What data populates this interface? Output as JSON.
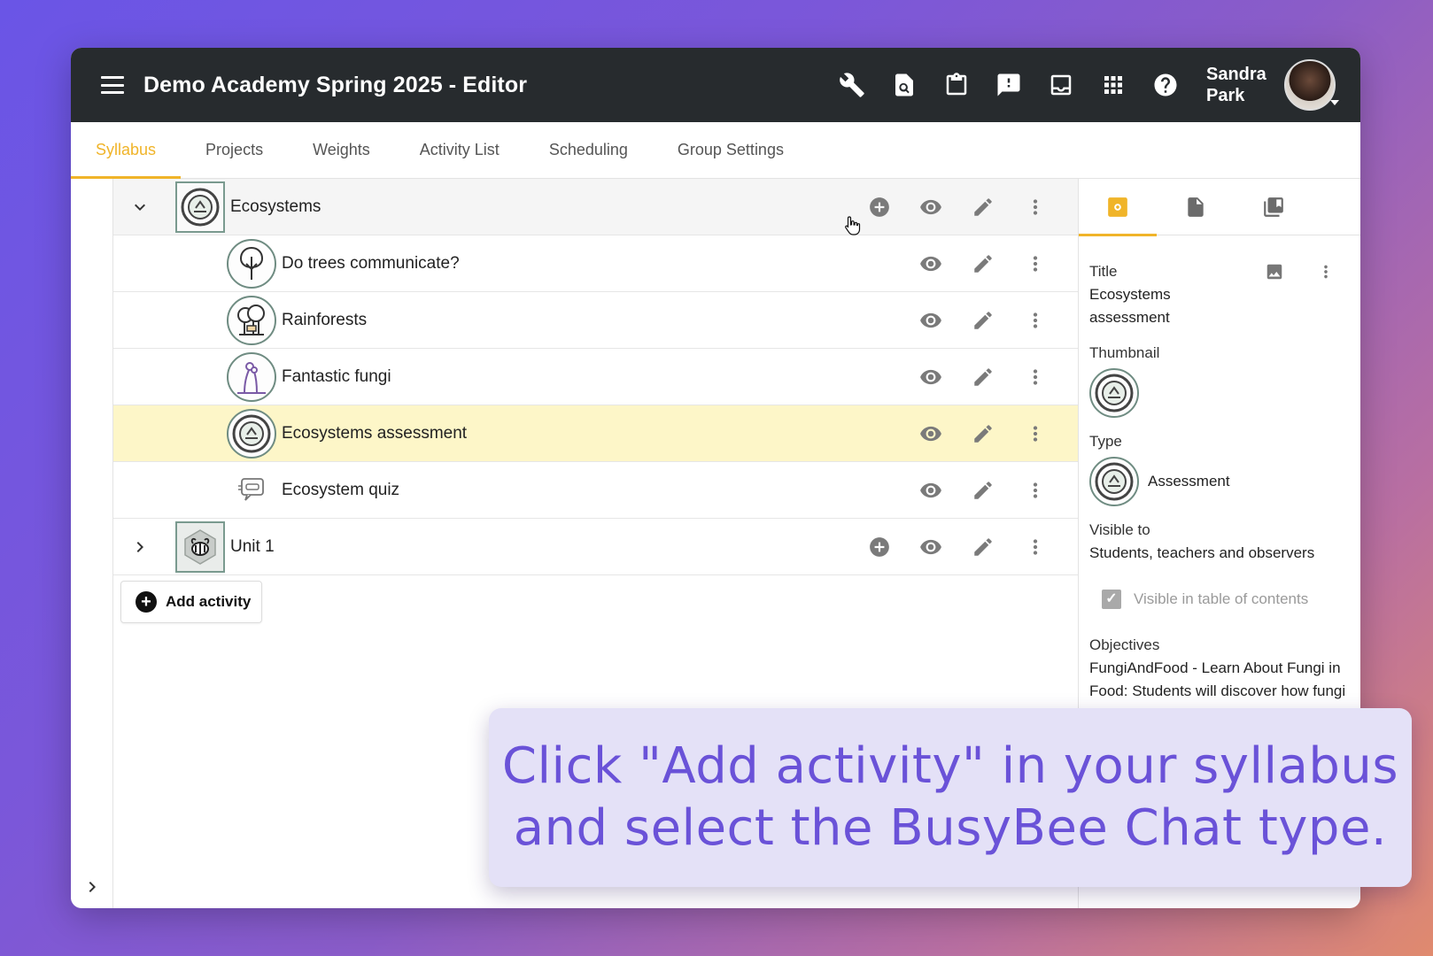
{
  "header": {
    "title": "Demo Academy Spring 2025 - Editor",
    "icons": [
      "wrench-icon",
      "search-document-icon",
      "clipboard-icon",
      "feedback-icon",
      "inbox-icon",
      "apps-grid-icon",
      "help-icon"
    ],
    "user": {
      "name": "Sandra Park"
    }
  },
  "tabs": [
    {
      "label": "Syllabus",
      "active": true
    },
    {
      "label": "Projects"
    },
    {
      "label": "Weights"
    },
    {
      "label": "Activity List"
    },
    {
      "label": "Scheduling"
    },
    {
      "label": "Group Settings"
    }
  ],
  "syllabus": {
    "rows": [
      {
        "label": "Ecosystems",
        "kind": "unit",
        "expanded": true
      },
      {
        "label": "Do trees communicate?",
        "kind": "activity"
      },
      {
        "label": "Rainforests",
        "kind": "activity"
      },
      {
        "label": "Fantastic fungi",
        "kind": "activity"
      },
      {
        "label": "Ecosystems assessment",
        "kind": "activity",
        "selected": true
      },
      {
        "label": "Ecosystem quiz",
        "kind": "activity"
      },
      {
        "label": "Unit 1",
        "kind": "unit",
        "expanded": false
      }
    ],
    "add_activity_label": "Add activity"
  },
  "properties": {
    "title_label": "Title",
    "title_value": "Ecosystems assessment",
    "thumbnail_label": "Thumbnail",
    "type_label": "Type",
    "type_value": "Assessment",
    "visible_label": "Visible to",
    "visible_value": "Students, teachers and observers",
    "toc_label": "Visible in table of contents",
    "toc_checked": true,
    "objectives_label": "Objectives",
    "objectives_value": "FungiAndFood - Learn About Fungi in Food: Students will discover how fungi"
  },
  "caption": {
    "line1": "Click \"Add activity\" in your syllabus",
    "line2": "and select the BusyBee Chat type."
  },
  "colors": {
    "accent": "#f0b429",
    "topbar": "#272b2e",
    "selected_row": "#fdf6c8",
    "caption_text": "#6a52d8"
  }
}
